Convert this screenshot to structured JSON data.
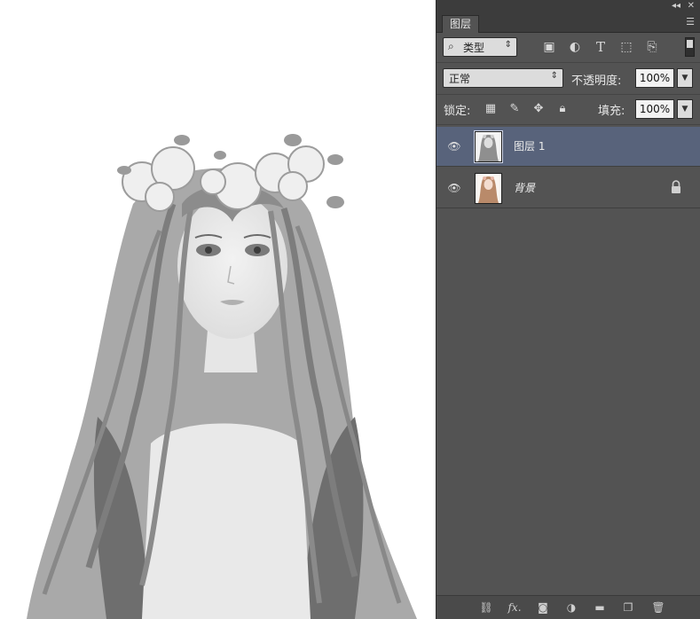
{
  "window": {
    "collapse_icon": "double-chevron-left-icon",
    "close_icon": "close-icon"
  },
  "panel": {
    "tab_label": "图层",
    "menu_icon": "panel-menu-icon"
  },
  "filter": {
    "search_icon": "search-icon",
    "kind_label": "类型",
    "icons": [
      "image-filter-icon",
      "adjustment-filter-icon",
      "type-filter-icon",
      "shape-filter-icon",
      "smart-object-filter-icon"
    ]
  },
  "blend": {
    "mode": "正常",
    "opacity_label": "不透明度:",
    "opacity_value": "100%"
  },
  "lock": {
    "label": "锁定:",
    "icons": [
      "lock-transparent-icon",
      "lock-image-icon",
      "lock-position-icon",
      "lock-all-icon"
    ],
    "fill_label": "填充:",
    "fill_value": "100%"
  },
  "layers": [
    {
      "name": "图层 1",
      "selected": true,
      "locked": false,
      "thumb": "grayscale-portrait"
    },
    {
      "name": "背景",
      "selected": false,
      "locked": true,
      "thumb": "color-portrait"
    }
  ],
  "bottom_toolbar": {
    "icons": [
      "link-layers-icon",
      "fx-icon",
      "layer-mask-icon",
      "adjustment-layer-icon",
      "new-group-icon",
      "new-layer-icon",
      "delete-layer-icon"
    ],
    "fx_label": "fx."
  },
  "colors": {
    "panel_bg": "#535353",
    "selected_layer": "#58637b",
    "topbar": "#3c3c3c"
  }
}
